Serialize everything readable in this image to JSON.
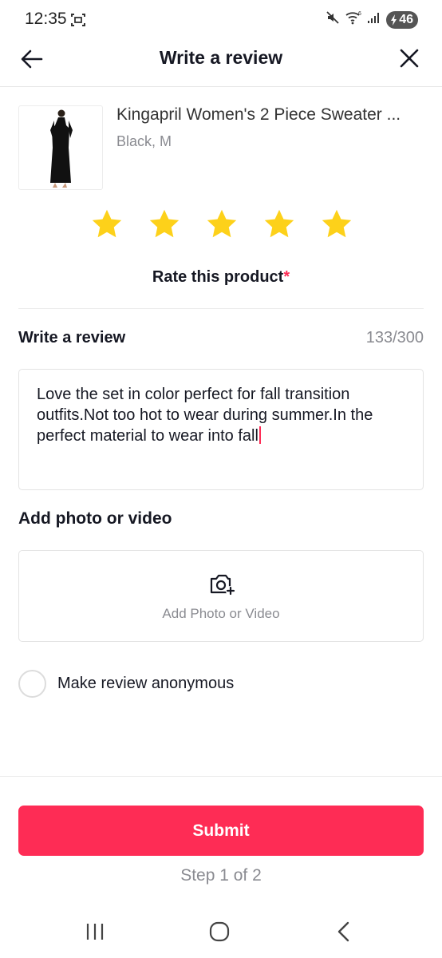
{
  "status_bar": {
    "time": "12:35",
    "battery": "46"
  },
  "header": {
    "title": "Write a review"
  },
  "product": {
    "name": "Kingapril Women's 2 Piece Sweater ...",
    "variant": "Black, M"
  },
  "rating": {
    "stars_selected": 5,
    "stars_total": 5,
    "label": "Rate this product",
    "required_mark": "*",
    "star_color": "#fdd11a"
  },
  "review": {
    "label": "Write a review",
    "count": "133/300",
    "text": "Love the set in color perfect for fall transition outfits.Not too hot to wear during summer.In the perfect material to wear into fall"
  },
  "media": {
    "label": "Add photo or video",
    "button_text": "Add Photo or Video",
    "icon": "camera-plus-icon"
  },
  "anonymous": {
    "label": "Make review anonymous",
    "checked": false
  },
  "submit": {
    "label": "Submit",
    "color": "#fe2c55"
  },
  "step": {
    "label": "Step 1 of 2"
  }
}
